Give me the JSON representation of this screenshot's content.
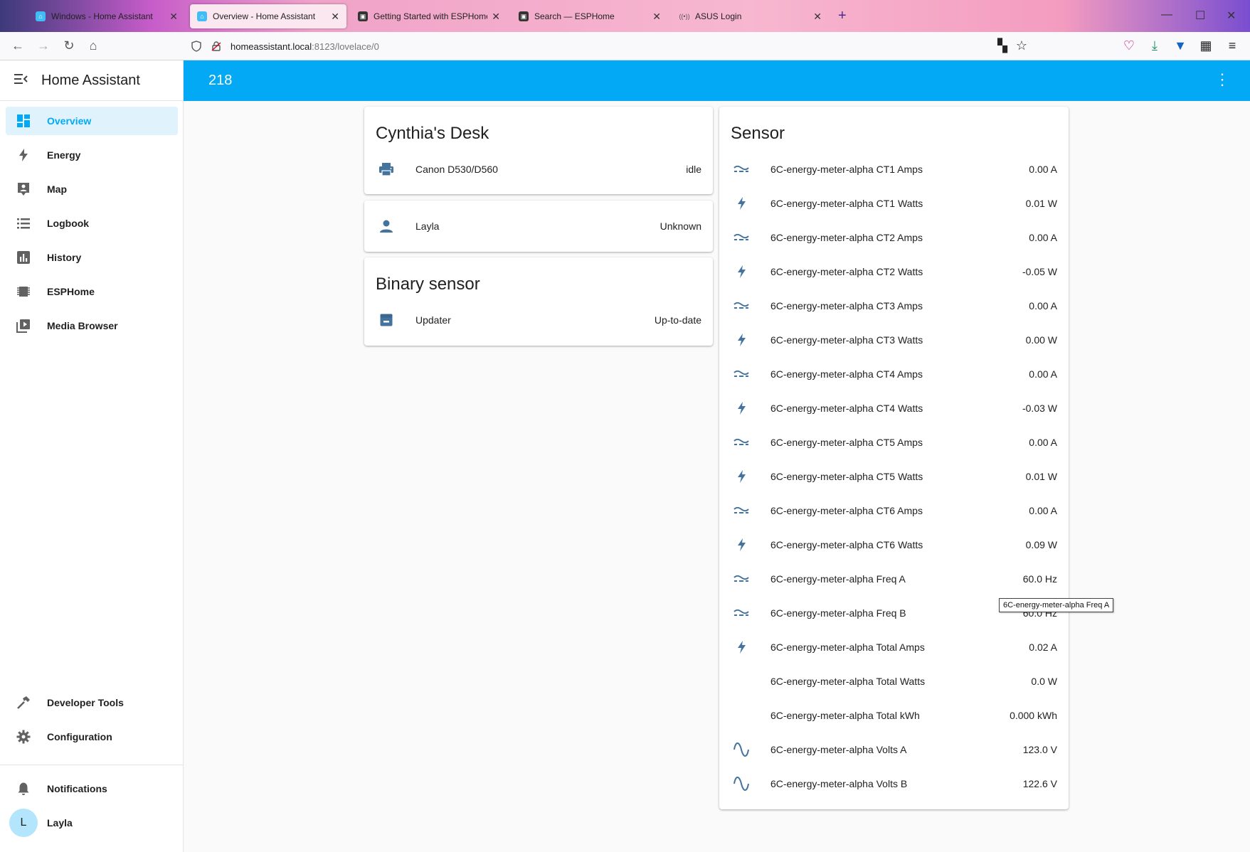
{
  "browser": {
    "tabs": [
      {
        "label": "Windows - Home Assistant",
        "active": false
      },
      {
        "label": "Overview - Home Assistant",
        "active": true
      },
      {
        "label": "Getting Started with ESPHome a",
        "active": false
      },
      {
        "label": "Search — ESPHome",
        "active": false
      },
      {
        "label": "ASUS Login",
        "active": false
      }
    ],
    "url_host": "homeassistant.local",
    "url_path": ":8123/lovelace/0"
  },
  "sidebar": {
    "title": "Home Assistant",
    "items": [
      {
        "label": "Overview",
        "icon": "view-dashboard-icon"
      },
      {
        "label": "Energy",
        "icon": "lightning-bolt-icon"
      },
      {
        "label": "Map",
        "icon": "map-account-icon"
      },
      {
        "label": "Logbook",
        "icon": "format-list-icon"
      },
      {
        "label": "History",
        "icon": "chart-box-icon"
      },
      {
        "label": "ESPHome",
        "icon": "chip-icon"
      },
      {
        "label": "Media Browser",
        "icon": "play-box-multiple-icon"
      }
    ],
    "bottom_items": [
      {
        "label": "Developer Tools",
        "icon": "hammer-icon"
      },
      {
        "label": "Configuration",
        "icon": "cog-icon"
      }
    ],
    "notifications_label": "Notifications",
    "user": {
      "initial": "L",
      "name": "Layla"
    }
  },
  "header": {
    "title": "218"
  },
  "cards": {
    "desk": {
      "title": "Cynthia's Desk",
      "entity": {
        "name": "Canon D530/D560",
        "state": "idle",
        "icon": "printer-icon"
      }
    },
    "person": {
      "name": "Layla",
      "state": "Unknown",
      "icon": "account-icon"
    },
    "binary": {
      "title": "Binary sensor",
      "entity": {
        "name": "Updater",
        "state": "Up-to-date",
        "icon": "package-icon"
      }
    },
    "sensor": {
      "title": "Sensor",
      "rows": [
        {
          "name": "6C-energy-meter-alpha CT1 Amps",
          "state": "0.00 A",
          "icon": "current-ac-icon"
        },
        {
          "name": "6C-energy-meter-alpha CT1 Watts",
          "state": "0.01 W",
          "icon": "flash-icon"
        },
        {
          "name": "6C-energy-meter-alpha CT2 Amps",
          "state": "0.00 A",
          "icon": "current-ac-icon"
        },
        {
          "name": "6C-energy-meter-alpha CT2 Watts",
          "state": "-0.05 W",
          "icon": "flash-icon"
        },
        {
          "name": "6C-energy-meter-alpha CT3 Amps",
          "state": "0.00 A",
          "icon": "current-ac-icon"
        },
        {
          "name": "6C-energy-meter-alpha CT3 Watts",
          "state": "0.00 W",
          "icon": "flash-icon"
        },
        {
          "name": "6C-energy-meter-alpha CT4 Amps",
          "state": "0.00 A",
          "icon": "current-ac-icon"
        },
        {
          "name": "6C-energy-meter-alpha CT4 Watts",
          "state": "-0.03 W",
          "icon": "flash-icon"
        },
        {
          "name": "6C-energy-meter-alpha CT5 Amps",
          "state": "0.00 A",
          "icon": "current-ac-icon"
        },
        {
          "name": "6C-energy-meter-alpha CT5 Watts",
          "state": "0.01 W",
          "icon": "flash-icon"
        },
        {
          "name": "6C-energy-meter-alpha CT6 Amps",
          "state": "0.00 A",
          "icon": "current-ac-icon"
        },
        {
          "name": "6C-energy-meter-alpha CT6 Watts",
          "state": "0.09 W",
          "icon": "flash-icon"
        },
        {
          "name": "6C-energy-meter-alpha Freq A",
          "state": "60.0 Hz",
          "icon": "current-ac-icon"
        },
        {
          "name": "6C-energy-meter-alpha Freq B",
          "state": "60.0 Hz",
          "icon": "current-ac-icon"
        },
        {
          "name": "6C-energy-meter-alpha Total Amps",
          "state": "0.02 A",
          "icon": "flash-icon"
        },
        {
          "name": "6C-energy-meter-alpha Total Watts",
          "state": "0.0 W",
          "icon": ""
        },
        {
          "name": "6C-energy-meter-alpha Total kWh",
          "state": "0.000 kWh",
          "icon": ""
        },
        {
          "name": "6C-energy-meter-alpha Volts A",
          "state": "123.0 V",
          "icon": "sine-wave-icon"
        },
        {
          "name": "6C-energy-meter-alpha Volts B",
          "state": "122.6 V",
          "icon": "sine-wave-icon"
        }
      ]
    }
  },
  "tooltip": "6C-energy-meter-alpha Freq A",
  "colors": {
    "primary": "#03a9f4",
    "icon": "#44739e",
    "sidebar_icon": "#616161"
  }
}
